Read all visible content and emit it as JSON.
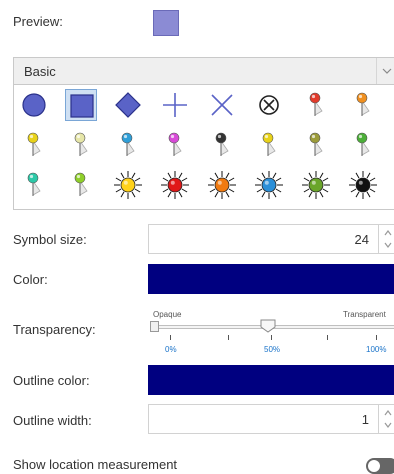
{
  "preview": {
    "label": "Preview:",
    "color": "#8b8bd4"
  },
  "dropdown": {
    "value": "Basic"
  },
  "symbols": [
    "circle-icon",
    "square-icon",
    "diamond-icon",
    "cross-icon",
    "x-icon",
    "circled-x-icon",
    "pin-red-icon",
    "pin-orange-icon",
    "pin-yellow-icon",
    "pin-cream-icon",
    "pin-blue-icon",
    "pin-magenta-icon",
    "pin-black-icon",
    "pin-yellow-icon",
    "pin-olive-icon",
    "pin-green-icon",
    "pin-teal-icon",
    "pin-lime-icon",
    "sun-yellow-icon",
    "sun-red-icon",
    "sun-orange-icon",
    "sun-blue-icon",
    "sun-green-icon",
    "sun-black-icon"
  ],
  "selected_symbol": "square-icon",
  "symbol_size": {
    "label": "Symbol size:",
    "value": "24"
  },
  "color": {
    "label": "Color:",
    "value": "#000080"
  },
  "transparency": {
    "label": "Transparency:",
    "min_label": "Opaque",
    "max_label": "Transparent",
    "tick_labels": [
      "0%",
      "50%",
      "100%"
    ],
    "value_percent": 50
  },
  "outline_color": {
    "label": "Outline color:",
    "value": "#000080"
  },
  "outline_width": {
    "label": "Outline width:",
    "value": "1"
  },
  "location_measurement": {
    "label": "Show location measurement",
    "enabled": false
  }
}
